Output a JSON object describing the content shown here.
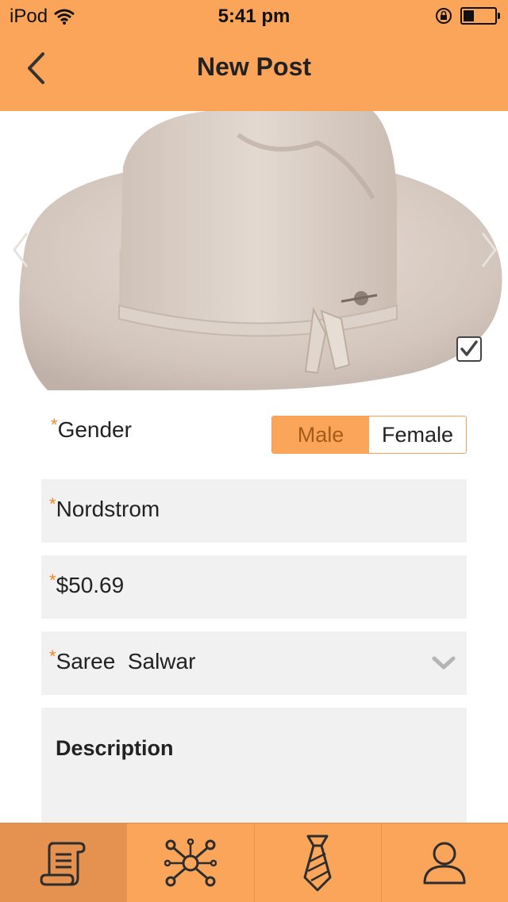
{
  "status_bar": {
    "carrier": "iPod",
    "time": "5:41 pm",
    "battery_level": 0.35
  },
  "nav": {
    "title": "New Post"
  },
  "colors": {
    "accent": "#fba55b",
    "accent_dark": "#e59250",
    "required": "#f08a24",
    "field_bg": "#f1f1f1"
  },
  "form": {
    "required_marker": "*",
    "gender_label": "Gender",
    "gender_options": [
      "Male",
      "Female"
    ],
    "gender_selected": "Male",
    "store": "Nordstrom",
    "price": "$50.69",
    "category": "Saree  Salwar",
    "description_placeholder": "Description"
  },
  "tabs": [
    {
      "icon": "scroll-icon",
      "active": true
    },
    {
      "icon": "network-icon",
      "active": false
    },
    {
      "icon": "tie-icon",
      "active": false
    },
    {
      "icon": "user-icon",
      "active": false
    }
  ]
}
